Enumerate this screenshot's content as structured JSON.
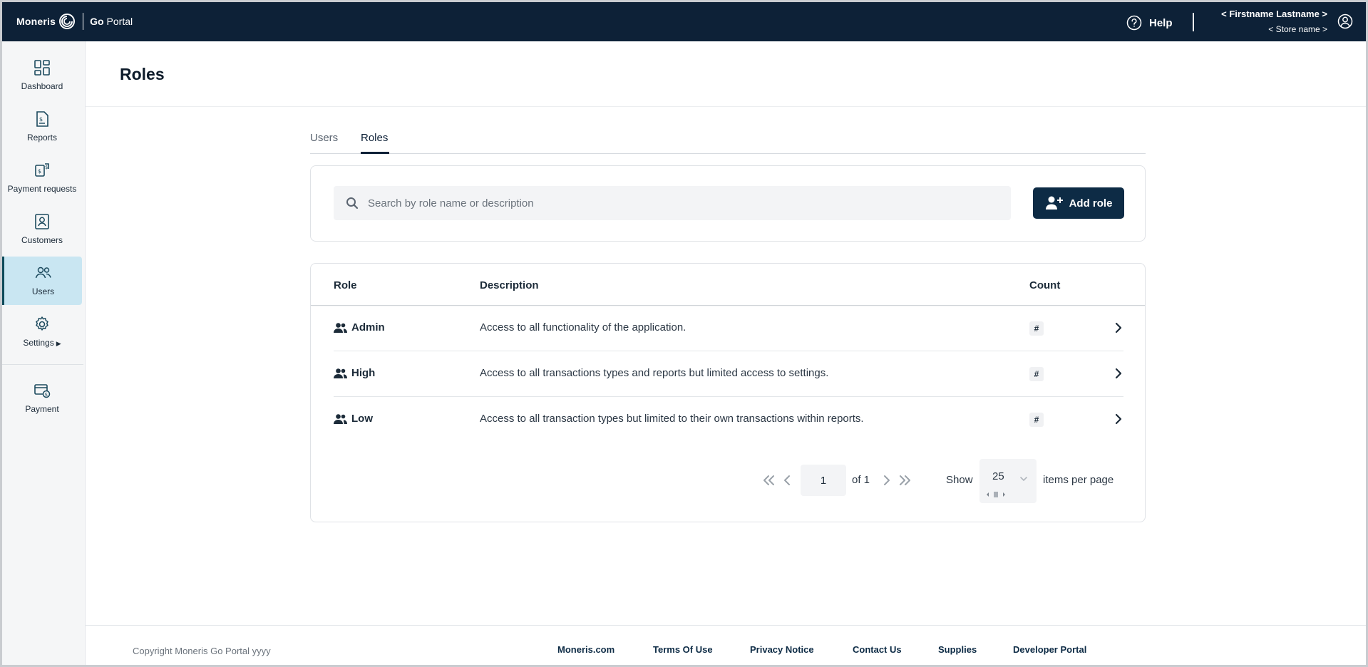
{
  "header": {
    "brand_name": "Moneris",
    "product_go": "Go",
    "product_portal": "Portal",
    "help_label": "Help",
    "user_name": "< Firstname Lastname >",
    "store_name": "< Store name >"
  },
  "sidebar": {
    "items": [
      {
        "label": "Dashboard",
        "icon": "dashboard-icon"
      },
      {
        "label": "Reports",
        "icon": "reports-icon"
      },
      {
        "label": "Payment requests",
        "icon": "payment-requests-icon"
      },
      {
        "label": "Customers",
        "icon": "customers-icon"
      },
      {
        "label": "Users",
        "icon": "users-icon",
        "active": true
      },
      {
        "label": "Settings",
        "icon": "settings-icon"
      },
      {
        "label": "Payment",
        "icon": "payment-icon"
      }
    ]
  },
  "page": {
    "title": "Roles",
    "tabs": [
      {
        "label": "Users",
        "active": false
      },
      {
        "label": "Roles",
        "active": true
      }
    ]
  },
  "search": {
    "placeholder": "Search by role name or description",
    "value": ""
  },
  "actions": {
    "add_role_label": "Add role"
  },
  "table": {
    "columns": [
      "Role",
      "Description",
      "Count"
    ],
    "rows": [
      {
        "role": "Admin",
        "description": "Access to all functionality of the application.",
        "count": "#"
      },
      {
        "role": "High",
        "description": "Access to all transactions types and reports but limited access to settings.",
        "count": "#"
      },
      {
        "role": "Low",
        "description": "Access to all transaction types but limited to their own transactions within reports.",
        "count": "#"
      }
    ]
  },
  "pagination": {
    "current_page": "1",
    "of_label": "of 1",
    "show_label": "Show",
    "per_page": "25",
    "items_label": "items per page"
  },
  "footer": {
    "copyright": "Copyright Moneris Go Portal  yyyy",
    "links": [
      "Moneris.com",
      "Terms Of Use",
      "Privacy Notice",
      "Contact Us",
      "Supplies",
      "Developer Portal"
    ]
  },
  "colors": {
    "header_bg": "#0d2137",
    "primary_button": "#0d2b45",
    "active_nav_bg": "#c9e6f2",
    "sidebar_bg": "#f5f6f7"
  }
}
